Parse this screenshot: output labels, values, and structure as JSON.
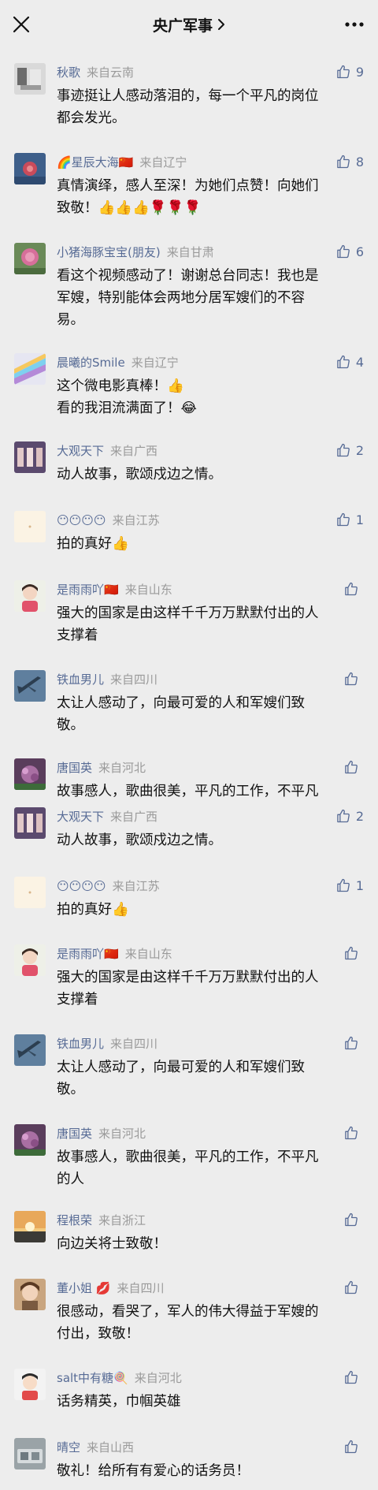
{
  "header": {
    "title": "央广军事"
  },
  "comments": [
    {
      "name": "秋歌",
      "from": "来自云南",
      "likes": "9",
      "lines": [
        "事迹挺让人感动落泪的，每一个平凡的岗位",
        "都会发光。"
      ]
    },
    {
      "name": "🌈星辰大海🇨🇳",
      "from": "来自辽宁",
      "likes": "8",
      "lines": [
        "真情演绎，感人至深！为她们点赞！向她们",
        "致敬！👍👍👍🌹🌹🌹"
      ]
    },
    {
      "name": "小猪海豚宝宝(朋友)",
      "from": "来自甘肃",
      "likes": "6",
      "lines": [
        "看这个视频感动了！谢谢总台同志！我也是",
        "军嫂，特别能体会两地分居军嫂们的不容",
        "易。"
      ]
    },
    {
      "name": "晨曦的Smile",
      "from": "来自辽宁",
      "likes": "4",
      "lines": [
        "这个微电影真棒！👍",
        "看的我泪流满面了！😂"
      ]
    },
    {
      "name": "大观天下",
      "from": "来自广西",
      "likes": "2",
      "lines": [
        "动人故事，歌颂戍边之情。"
      ]
    },
    {
      "name": "😶😶😶😶",
      "from": "来自江苏",
      "likes": "1",
      "lines": [
        "拍的真好👍"
      ]
    },
    {
      "name": "是雨雨吖🇨🇳",
      "from": "来自山东",
      "likes": "",
      "lines": [
        "强大的国家是由这样千千万万默默付出的人",
        "支撑着"
      ]
    },
    {
      "name": "铁血男儿",
      "from": "来自四川",
      "likes": "",
      "lines": [
        "太让人感动了，向最可爱的人和军嫂们致",
        "敬。"
      ]
    },
    {
      "name": "唐国英",
      "from": "来自河北",
      "likes": "",
      "lines": [
        "故事感人，歌曲很美，平凡的工作，不平凡"
      ]
    },
    {
      "name": "大观天下",
      "from": "来自广西",
      "likes": "2",
      "lines": [
        "动人故事，歌颂戍边之情。"
      ]
    },
    {
      "name": "😶😶😶😶",
      "from": "来自江苏",
      "likes": "1",
      "lines": [
        "拍的真好👍"
      ]
    },
    {
      "name": "是雨雨吖🇨🇳",
      "from": "来自山东",
      "likes": "",
      "lines": [
        "强大的国家是由这样千千万万默默付出的人",
        "支撑着"
      ]
    },
    {
      "name": "铁血男儿",
      "from": "来自四川",
      "likes": "",
      "lines": [
        "太让人感动了，向最可爱的人和军嫂们致",
        "敬。"
      ]
    },
    {
      "name": "唐国英",
      "from": "来自河北",
      "likes": "",
      "lines": [
        "故事感人，歌曲很美，平凡的工作，不平凡",
        "的人"
      ]
    },
    {
      "name": "程根荣",
      "from": "来自浙江",
      "likes": "",
      "lines": [
        "向边关将士致敬！"
      ]
    },
    {
      "name": "董小姐 💋",
      "from": "来自四川",
      "likes": "",
      "lines": [
        "很感动，看哭了，军人的伟大得益于军嫂的",
        "付出，致敬！"
      ]
    },
    {
      "name": "salt中有糖🍭",
      "from": "来自河北",
      "likes": "",
      "lines": [
        "话务精英，巾帼英雄"
      ]
    },
    {
      "name": "晴空",
      "from": "来自山西",
      "likes": "",
      "lines": [
        "敬礼！给所有有爱心的话务员！"
      ]
    }
  ],
  "colors": {
    "background": "#ededed",
    "name": "#576b95",
    "region": "#9a9a9a",
    "text": "#111111"
  },
  "icons": {
    "close": "close-icon",
    "more": "more-icon",
    "like": "thumbs-up-icon",
    "chevron": "chevron-right-icon"
  }
}
